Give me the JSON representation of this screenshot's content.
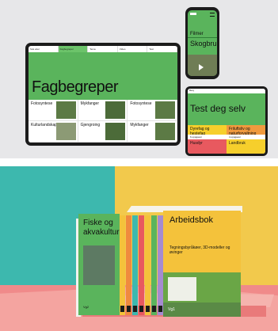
{
  "tablet": {
    "nav": [
      "Sok etter",
      "Fagbegreper",
      "Tema",
      "Video",
      "Test"
    ],
    "hero_title": "Fagbegreper",
    "cards": [
      "Fotosyntese",
      "Mykfanger",
      "Fotosyntese",
      "Kulturlandskap",
      "Gjengroing",
      "Mykfanger"
    ]
  },
  "phone": {
    "kicker": "Filmer",
    "title": "Skogbruk"
  },
  "small_tablet": {
    "header": "Meny",
    "hero_title": "Test deg selv",
    "tiles": [
      {
        "label": "Dyrefag og hestefag",
        "tag": "6 oppgaver",
        "color": "#f6cf2c"
      },
      {
        "label": "Friluftsliv og naturforvaltning",
        "tag": "4 oppgaver",
        "color": "#f09a3e"
      },
      {
        "label": "Husdyr",
        "tag": "",
        "color": "#e8595f"
      },
      {
        "label": "Landbruk",
        "tag": "",
        "color": "#f6cf2c"
      }
    ]
  },
  "books": {
    "left_title_1": "Fiske og",
    "left_title_2": "akvakultur",
    "left_footer": "Vg2",
    "spines": [
      {
        "color": "#f4c23b"
      },
      {
        "color": "#f08a3e"
      },
      {
        "color": "#3db8ae"
      },
      {
        "color": "#e8595f"
      },
      {
        "color": "#f4c23b"
      },
      {
        "color": "#5ab45c"
      },
      {
        "color": "#a58bd0"
      }
    ],
    "right_title": "Arbeidsbok",
    "right_subtitle": "Tegningsbyråkøer, 3D-modeller og øvinger",
    "right_footer": "Vg1"
  }
}
